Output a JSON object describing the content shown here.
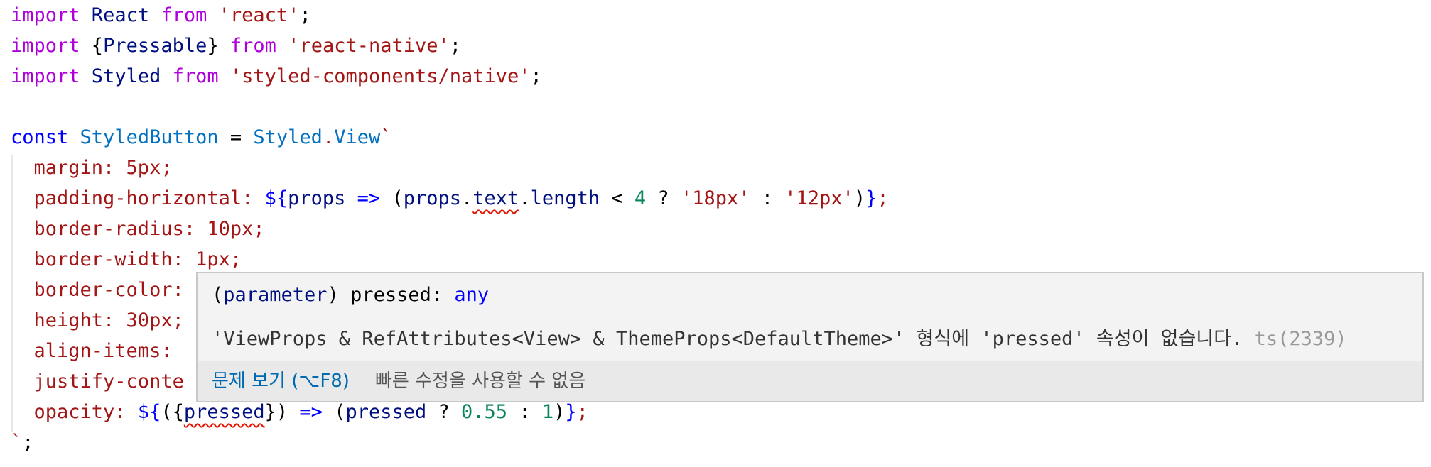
{
  "code": {
    "l1": {
      "t1": "import",
      "t2": " React ",
      "t3": "from",
      "t4": " ",
      "t5": "'react'",
      "t6": ";"
    },
    "l2": {
      "t1": "import",
      "t2": " {",
      "t3": "Pressable",
      "t4": "} ",
      "t5": "from",
      "t6": " ",
      "t7": "'react-native'",
      "t8": ";"
    },
    "l3": {
      "t1": "import",
      "t2": " Styled ",
      "t3": "from",
      "t4": " ",
      "t5": "'styled-components/native'",
      "t6": ";"
    },
    "l5": {
      "t1": "const",
      "t2": " ",
      "t3": "StyledButton",
      "t4": " = ",
      "t5": "Styled",
      "t6": ".",
      "t7": "View",
      "t8": "`"
    },
    "l6": {
      "t1": "  margin: 5px;"
    },
    "l7": {
      "t1": "  padding-horizontal: ",
      "t2": "${",
      "t3": "props",
      "t4": " => ",
      "t5": "(",
      "t6": "props",
      "t7": ".",
      "t8": "text",
      "t9": ".",
      "t10": "length",
      "t11": " < ",
      "t12": "4",
      "t13": " ? ",
      "t14": "'18px'",
      "t15": " : ",
      "t16": "'12px'",
      "t17": ")",
      "t18": "}",
      "t19": ";"
    },
    "l8": {
      "t1": "  border-radius: 10px;"
    },
    "l9": {
      "t1": "  border-width: 1px;"
    },
    "l10": {
      "t1": "  border-color: "
    },
    "l11": {
      "t1": "  height: 30px;"
    },
    "l12": {
      "t1": "  align-items: "
    },
    "l13": {
      "t1": "  justify-conte"
    },
    "l14": {
      "t1": "  opacity: ",
      "t2": "${",
      "t3": "({",
      "t4": "pressed",
      "t5": "}) ",
      "t6": "=>",
      "t7": " (",
      "t8": "pressed",
      "t9": " ? ",
      "t10": "0.55",
      "t11": " : ",
      "t12": "1",
      "t13": ")",
      "t14": "}",
      "t15": ";"
    },
    "l15": {
      "t1": "`",
      "t2": ";"
    }
  },
  "hover": {
    "sig_open": "(",
    "sig_param": "parameter",
    "sig_close": ") pressed: ",
    "sig_type": "any",
    "message": "'ViewProps & RefAttributes<View> & ThemeProps<DefaultTheme>' 형식에 'pressed' 속성이 없습니다. ",
    "code": "ts(2339)",
    "view_problem": "문제 보기 (⌥F8)",
    "no_fix": "빠른 수정을 사용할 수 없음"
  }
}
